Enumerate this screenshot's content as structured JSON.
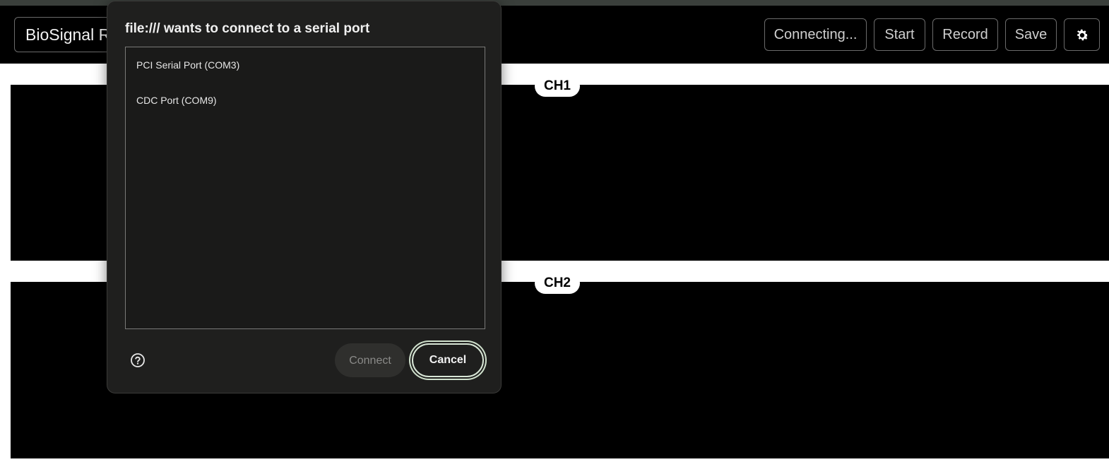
{
  "header": {
    "app_title": "BioSignal Recorder",
    "buttons": {
      "connect": "Connecting...",
      "start": "Start",
      "record": "Record",
      "save": "Save"
    },
    "settings_icon": "gear-icon"
  },
  "channels": [
    {
      "label": "CH1"
    },
    {
      "label": "CH2"
    }
  ],
  "dialog": {
    "title": "file:/// wants to connect to a serial port",
    "ports": [
      {
        "name": "PCI Serial Port (COM3)"
      },
      {
        "name": "CDC Port (COM9)"
      }
    ],
    "help_icon": "question-circle-icon",
    "connect_label": "Connect",
    "cancel_label": "Cancel"
  },
  "colors": {
    "background": "#000000",
    "dialog_bg": "#1f1f1e",
    "focus_ring": "#cfe0cc"
  }
}
